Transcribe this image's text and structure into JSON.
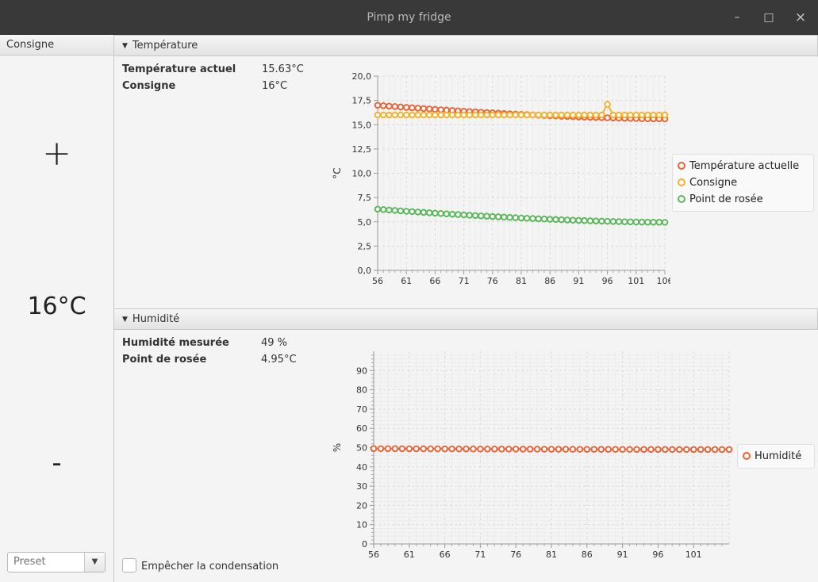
{
  "window": {
    "title": "Pimp my fridge",
    "minimize": "–",
    "maximize": "□",
    "close": "×"
  },
  "left": {
    "header": "Consigne",
    "plus": "+",
    "setpoint": "16°C",
    "minus": "-",
    "preset_placeholder": "Preset",
    "preset_arrow": "▼"
  },
  "temperature": {
    "header": "Température",
    "fields": [
      {
        "label": "Température actuel",
        "value": "15.63°C"
      },
      {
        "label": "Consigne",
        "value": "16°C"
      }
    ]
  },
  "humidity": {
    "header": "Humidité",
    "fields": [
      {
        "label": "Humidité mesurée",
        "value": "49 %"
      },
      {
        "label": "Point de rosée",
        "value": "4.95°C"
      }
    ],
    "checkbox_label": "Empêcher la condensation"
  },
  "chart_data": [
    {
      "type": "line",
      "title": "",
      "xlabel": "",
      "ylabel": "°C",
      "xlim": [
        56,
        106
      ],
      "ylim": [
        0,
        20
      ],
      "xticks": [
        "56",
        "61",
        "66",
        "71",
        "76",
        "81",
        "86",
        "91",
        "96",
        "101",
        "106"
      ],
      "yticks": [
        "0,0",
        "2,5",
        "5,0",
        "7,5",
        "10,0",
        "12,5",
        "15,0",
        "17,5",
        "20,0"
      ],
      "grid": true,
      "legend": "right",
      "series": [
        {
          "name": "Température actuelle",
          "color": "#e8663a",
          "start": 17.0,
          "end": 15.6
        },
        {
          "name": "Consigne",
          "color": "#f4b12e",
          "start": 16.0,
          "end": 16.0,
          "spike_x": 96,
          "spike_y": 17.1
        },
        {
          "name": "Point de rosée",
          "color": "#5cb85c",
          "start": 6.3,
          "end": 4.95
        }
      ]
    },
    {
      "type": "line",
      "title": "",
      "xlabel": "",
      "ylabel": "%",
      "xlim": [
        56,
        106
      ],
      "ylim": [
        0,
        100
      ],
      "xticks": [
        "56",
        "61",
        "66",
        "71",
        "76",
        "81",
        "86",
        "91",
        "96",
        "101"
      ],
      "yticks": [
        "0",
        "10",
        "20",
        "30",
        "40",
        "50",
        "60",
        "70",
        "80",
        "90"
      ],
      "grid": true,
      "legend": "right",
      "series": [
        {
          "name": "Humidité",
          "color": "#e8663a",
          "start": 49.5,
          "end": 49.0
        }
      ]
    }
  ]
}
